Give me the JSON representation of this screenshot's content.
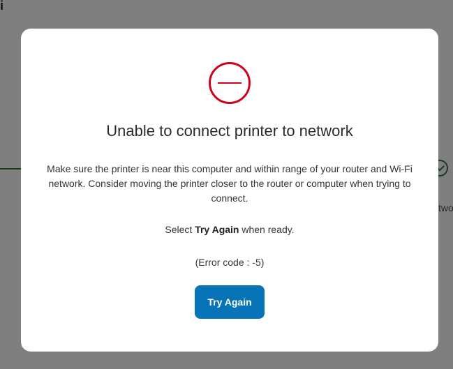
{
  "background": {
    "top_left_fragment": "i",
    "right_fragment": "two"
  },
  "modal": {
    "icon": "error-minus-circle-icon",
    "title": "Unable to connect printer to network",
    "message": "Make sure the printer is near this computer and within range of your router and Wi-Fi network. Consider moving the printer closer to the router or computer when trying to connect.",
    "select_prefix": "Select",
    "select_emphasis": "Try Again",
    "select_suffix": "when ready.",
    "error_code": "(Error code : -5)",
    "try_again_label": "Try Again"
  },
  "colors": {
    "accent": "#0774b8",
    "error": "#d0021b",
    "success": "#2e7d32"
  }
}
